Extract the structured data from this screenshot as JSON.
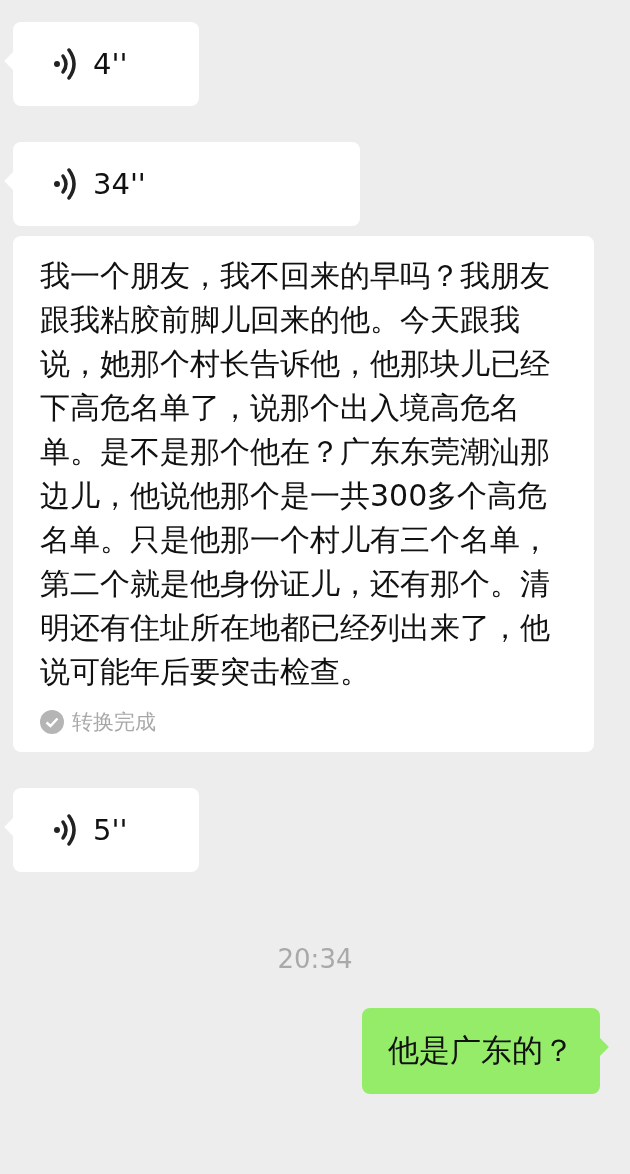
{
  "messages": [
    {
      "kind": "voice",
      "outgoing": false,
      "duration": "4''"
    },
    {
      "kind": "voice",
      "outgoing": false,
      "duration": "34''",
      "transcript": {
        "text": "我一个朋友，我不回来的早吗？我朋友跟我粘胶前脚儿回来的他。今天跟我说，她那个村长告诉他，他那块儿已经下高危名单了，说那个出入境高危名单。是不是那个他在？广东东莞潮汕那边儿，他说他那个是一共300多个高危名单。只是他那一个村儿有三个名单，第二个就是他身份证儿，还有那个。清明还有住址所在地都已经列出来了，他说可能年后要突击检查。",
        "status": "转换完成"
      }
    },
    {
      "kind": "voice",
      "outgoing": false,
      "duration": "5''"
    },
    {
      "kind": "time",
      "text": "20:34"
    },
    {
      "kind": "text",
      "outgoing": true,
      "text": "他是广东的？"
    }
  ]
}
